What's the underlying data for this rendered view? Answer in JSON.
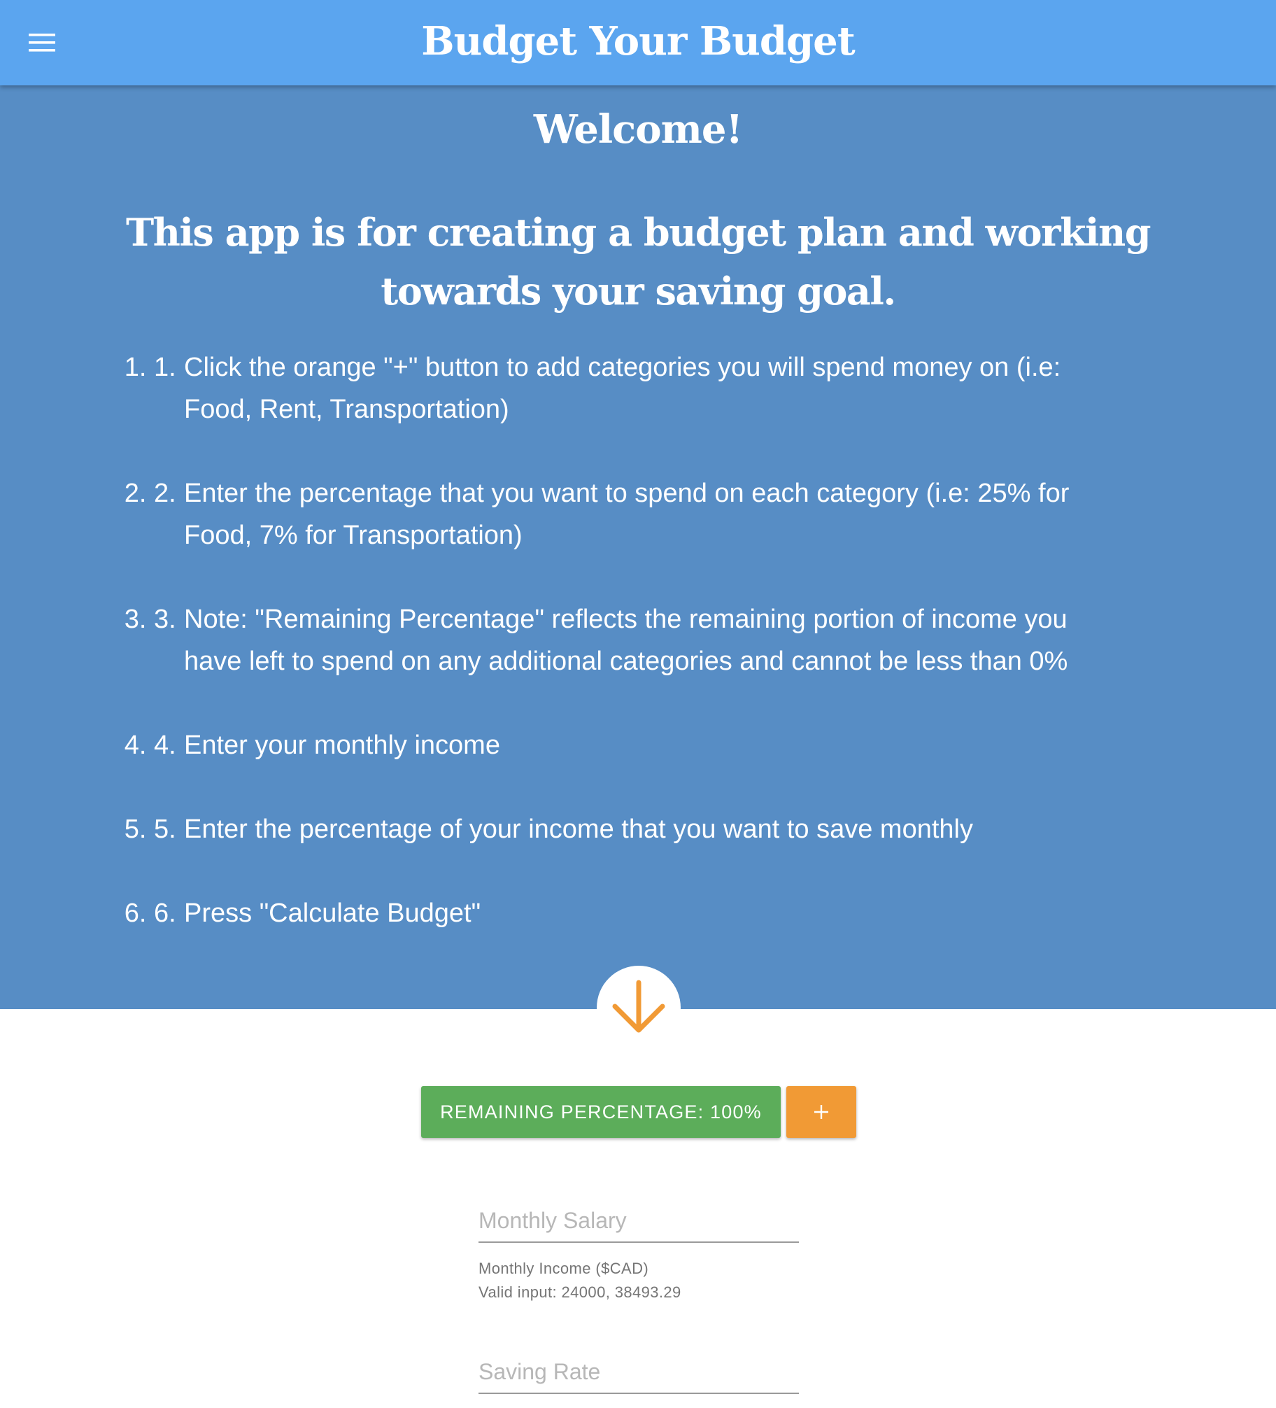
{
  "header": {
    "title": "Budget Your Budget",
    "menu_icon": "hamburger-menu-icon"
  },
  "hero": {
    "welcome": "Welcome!",
    "intro": "This app is for creating a budget plan and working towards your saving goal.",
    "steps": [
      {
        "num": "1.",
        "text": "Click the orange \"+\" button to add categories you will spend money on (i.e: Food, Rent, Transportation)"
      },
      {
        "num": "2.",
        "text": "Enter the percentage that you want to spend on each category (i.e: 25% for Food, 7% for Transportation)"
      },
      {
        "num": "3.",
        "text": "Note: \"Remaining Percentage\" reflects the remaining portion of income you have left to spend on any additional categories and cannot be less than 0%"
      },
      {
        "num": "4.",
        "text": "Enter your monthly income"
      },
      {
        "num": "5.",
        "text": "Enter the percentage of your income that you want to save monthly"
      },
      {
        "num": "6.",
        "text": "Press \"Calculate Budget\""
      }
    ],
    "scroll_icon": "arrow-down-icon"
  },
  "controls": {
    "remaining_label": "REMAINING PERCENTAGE: 100%",
    "add_icon": "plus-icon"
  },
  "form": {
    "salary": {
      "placeholder": "Monthly Salary",
      "value": "",
      "helper_label": "Monthly Income ($CAD)",
      "helper_example": "Valid input: 24000, 38493.29"
    },
    "saving_rate": {
      "placeholder": "Saving Rate",
      "value": ""
    }
  },
  "colors": {
    "app_bar": "#5ba5ef",
    "hero_bg": "#578dc5",
    "accent_orange": "#f19a35",
    "remaining_green": "#5cad5a"
  }
}
